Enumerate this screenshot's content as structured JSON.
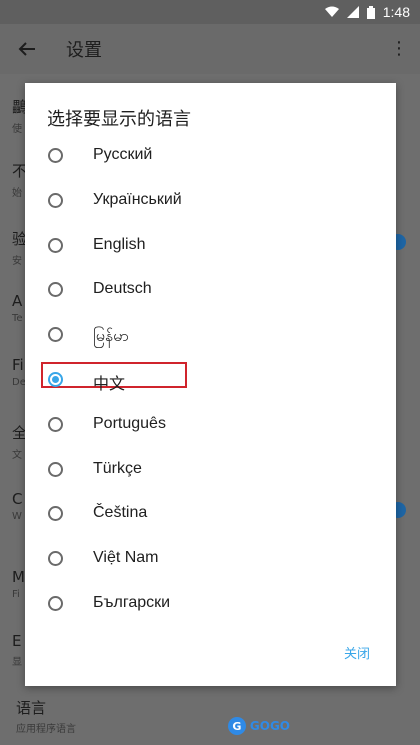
{
  "status_bar": {
    "time": "1:48"
  },
  "app_bar": {
    "title": "设置"
  },
  "background_items": [
    {
      "title": "鸓",
      "subtitle": "使"
    },
    {
      "title": "不",
      "subtitle": "始"
    },
    {
      "title": "验",
      "subtitle": "安"
    },
    {
      "title": "A",
      "subtitle": "Te"
    },
    {
      "title": "Fi",
      "subtitle": "De"
    },
    {
      "title": "全",
      "subtitle": "文"
    },
    {
      "title": "C",
      "subtitle": "W"
    },
    {
      "title": "M",
      "subtitle": "Fi"
    },
    {
      "title": "E",
      "subtitle": "显"
    }
  ],
  "bottom_item": {
    "title": "语言",
    "subtitle": "应用程序语言"
  },
  "dialog": {
    "title": "选择要显示的语言",
    "close_label": "关闭",
    "options": [
      {
        "label": "Русский",
        "selected": false
      },
      {
        "label": "Український",
        "selected": false
      },
      {
        "label": "English",
        "selected": false
      },
      {
        "label": "Deutsch",
        "selected": false
      },
      {
        "label": "မြန်မာ",
        "selected": false
      },
      {
        "label": "中文",
        "selected": true
      },
      {
        "label": "Português",
        "selected": false
      },
      {
        "label": "Türkçe",
        "selected": false
      },
      {
        "label": "Čeština",
        "selected": false
      },
      {
        "label": "Việt Nam",
        "selected": false
      },
      {
        "label": "Български",
        "selected": false
      }
    ]
  },
  "watermark": {
    "text": "GOGO"
  },
  "colors": {
    "accent": "#38a6e8",
    "highlight": "#d0242c"
  }
}
